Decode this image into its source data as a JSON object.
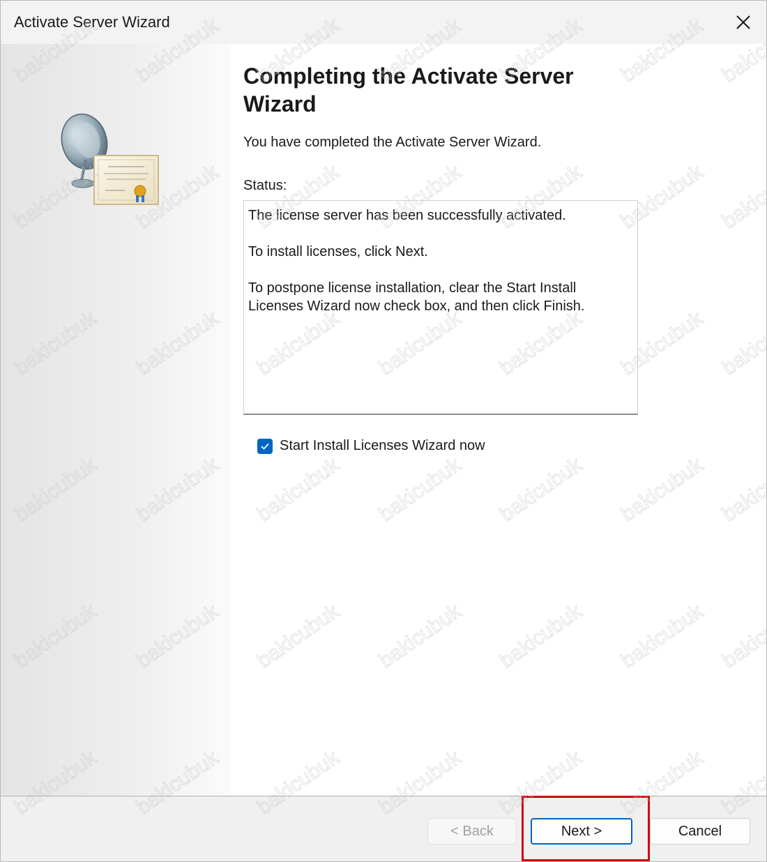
{
  "window": {
    "title": "Activate Server Wizard"
  },
  "content": {
    "heading": "Completing the Activate Server Wizard",
    "intro": "You have completed the Activate Server Wizard.",
    "status_label": "Status:",
    "status_lines": [
      "The license server has been successfully activated.",
      "To install licenses, click Next.",
      "To postpone license installation, clear the Start Install Licenses Wizard now check box, and then click Finish."
    ],
    "checkbox": {
      "label": "Start Install Licenses Wizard now",
      "checked": true
    }
  },
  "buttons": {
    "back": "< Back",
    "next": "Next >",
    "cancel": "Cancel"
  },
  "watermark": "bakicubuk",
  "colors": {
    "accent": "#0067c0",
    "highlight": "#d00000"
  },
  "icons": {
    "close": "close-icon",
    "wizard": "satellite-certificate-icon",
    "check": "checkmark-icon"
  }
}
